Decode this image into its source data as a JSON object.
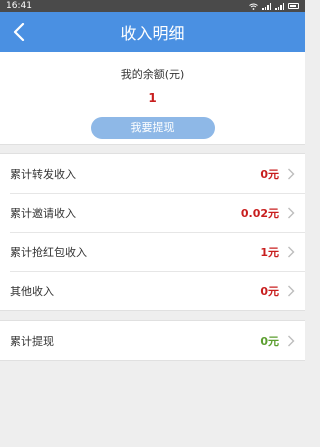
{
  "status_bar": {
    "time": "16:41"
  },
  "header": {
    "title": "收入明细"
  },
  "balance": {
    "label": "我的余额(元)",
    "value": "1",
    "withdraw_label": "我要提现"
  },
  "income_items": [
    {
      "label": "累计转发收入",
      "value": "0元"
    },
    {
      "label": "累计邀请收入",
      "value": "0.02元"
    },
    {
      "label": "累计抢红包收入",
      "value": "1元"
    },
    {
      "label": "其他收入",
      "value": "0元"
    }
  ],
  "withdraw_total": {
    "label": "累计提现",
    "value": "0元"
  },
  "colors": {
    "nav": "#4a90e2",
    "button": "#8eb8e7",
    "income_value": "#c81e1e",
    "withdraw_value": "#5b9e2f"
  }
}
